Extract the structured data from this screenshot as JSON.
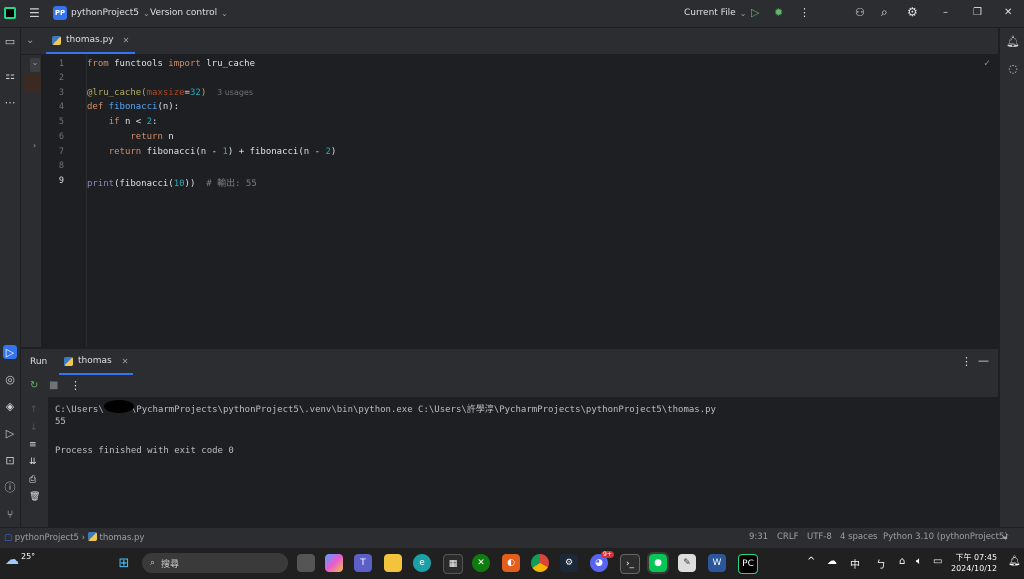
{
  "titlebar": {
    "project_badge": "PP",
    "project_name": "pythonProject5",
    "vcs": "Version control",
    "run_config": "Current File"
  },
  "tab": {
    "label": "thomas.py"
  },
  "editor": {
    "line_numbers": [
      "1",
      "2",
      "3",
      "4",
      "5",
      "6",
      "7",
      "8",
      "9"
    ],
    "lines": {
      "l1_kw1": "from",
      "l1_mod": " functools ",
      "l1_kw2": "import",
      "l1_name": " lru_cache",
      "l3_dec": "@lru_cache(",
      "l3_param": "maxsize",
      "l3_eq": "=",
      "l3_num": "32",
      "l3_close": ")",
      "l3_hint": "3 usages",
      "l4_kw": "def",
      "l4_fn": " fibonacci",
      "l4_rest": "(n):",
      "l5_kw": "if",
      "l5_rest": " n < ",
      "l5_num": "2",
      "l5_colon": ":",
      "l6_kw": "return",
      "l6_rest": " n",
      "l7_kw": "return",
      "l7_a": " fibonacci(n - ",
      "l7_n1": "1",
      "l7_b": ") + fibonacci(n - ",
      "l7_n2": "2",
      "l7_c": ")",
      "l9_a": "print",
      "l9_b": "(fibonacci(",
      "l9_num": "10",
      "l9_c": "))",
      "l9_comment": "# 輸出: 55"
    }
  },
  "run": {
    "title": "Run",
    "tab_label": "thomas",
    "console": [
      "C:\\Users\\     \\PycharmProjects\\pythonProject5\\.venv\\bin\\python.exe C:\\Users\\許學淳\\PycharmProjects\\pythonProject5\\thomas.py",
      "55",
      "",
      "Process finished with exit code 0"
    ]
  },
  "statusbar": {
    "breadcrumb_project": "pythonProject5",
    "breadcrumb_file": "thomas.py",
    "position": "9:31",
    "line_sep": "CRLF",
    "encoding": "UTF-8",
    "indent": "4 spaces",
    "interpreter": "Python 3.10 (pythonProject5)"
  },
  "taskbar": {
    "weather": "25°",
    "search": "搜尋",
    "ime": "中",
    "time": "下午 07:45",
    "date": "2024/10/12",
    "discord_badge": "9+"
  },
  "colors": {
    "accent": "#3574f0",
    "keyword": "#cf8e6d",
    "function": "#56a8f5",
    "number": "#2aacb8",
    "run_green": "#5fb865"
  },
  "icons": [
    "main-menu-icon",
    "run-icon",
    "debug-icon",
    "more-icon",
    "add-user-icon",
    "search-icon",
    "settings-icon",
    "project-icon",
    "structure-icon",
    "run-tool-icon",
    "python-console-icon",
    "layers-icon",
    "services-icon",
    "terminal-icon",
    "problems-icon",
    "git-icon",
    "notifications-icon",
    "ai-icon"
  ]
}
